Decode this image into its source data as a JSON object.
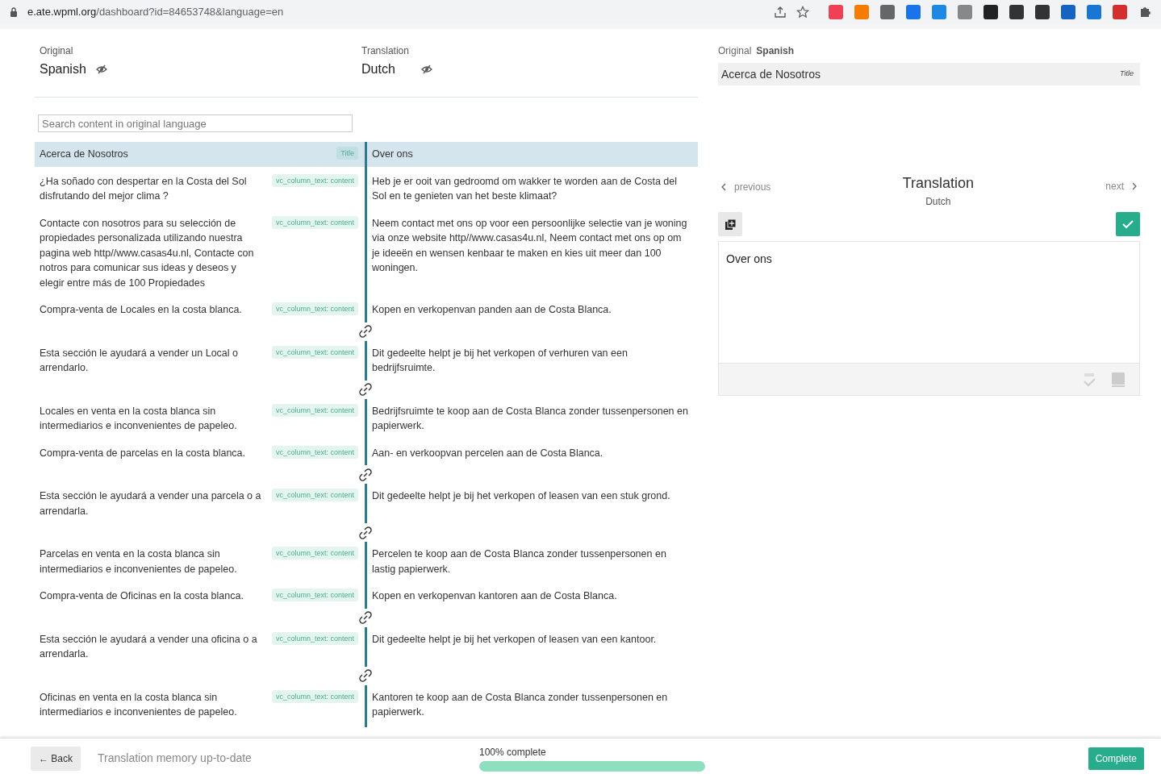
{
  "browser": {
    "url_host": "e.ate.wpml.org",
    "url_path": "/dashboard?id=84653748&language=en"
  },
  "header": {
    "original_label": "Original",
    "original_language": "Spanish",
    "translation_label": "Translation",
    "translation_language": "Dutch"
  },
  "search": {
    "placeholder": "Search content in original language"
  },
  "segments": [
    {
      "original": "Acerca de Nosotros",
      "tag": "Title",
      "translation": "Over ons",
      "selected": true,
      "linked_after": false
    },
    {
      "original": "¿Ha soñado con despertar en la Costa del Sol disfrutando del mejor clima ?",
      "tag": "vc_column_text: content",
      "translation": "Heb je er ooit van gedroomd om wakker te worden aan de Costa del Sol en te genieten van het beste klimaat?",
      "selected": false,
      "linked_after": false
    },
    {
      "original": "Contacte con nosotros para su selección de propiedades personalizada utilizando nuestra pagina web http//www.casas4u.nl, Contacte con notros para comunicar sus ideas y deseos y elegir entre más de 100 Propiedades",
      "tag": "vc_column_text: content",
      "translation": "Neem contact met ons op voor een persoonlijke selectie van je woning via onze website http//www.casas4u.nl, Neem contact met ons op om je ideeën en wensen kenbaar te maken en kies uit meer dan 100 woningen.",
      "selected": false,
      "linked_after": false
    },
    {
      "original": "Compra-venta de Locales en la costa blanca.",
      "tag": "vc_column_text: content",
      "translation": "Kopen en verkopenvan panden aan de Costa Blanca.",
      "selected": false,
      "linked_after": true
    },
    {
      "original": "Esta sección le ayudará a vender un Local o arrendarlo.",
      "tag": "vc_column_text: content",
      "translation": "Dit gedeelte helpt je bij het verkopen of verhuren van een bedrijfsruimte.",
      "selected": false,
      "linked_after": true
    },
    {
      "original": "Locales en venta en la costa blanca sin intermediarios e inconvenientes de papeleo.",
      "tag": "vc_column_text: content",
      "translation": "Bedrijfsruimte te koop aan de Costa Blanca zonder tussenpersonen en papierwerk.",
      "selected": false,
      "linked_after": false
    },
    {
      "original": "Compra-venta de parcelas en la costa blanca.",
      "tag": "vc_column_text: content",
      "translation": "Aan- en verkoopvan percelen aan de Costa Blanca.",
      "selected": false,
      "linked_after": true
    },
    {
      "original": "Esta sección le ayudará a vender una parcela o a arrendarla.",
      "tag": "vc_column_text: content",
      "translation": "Dit gedeelte helpt je bij het verkopen of leasen van een stuk grond.",
      "selected": false,
      "linked_after": true
    },
    {
      "original": "Parcelas en venta en la costa blanca sin intermediarios e inconvenientes de papeleo.",
      "tag": "vc_column_text: content",
      "translation": "Percelen te koop aan de Costa Blanca zonder tussenpersonen en lastig papierwerk.",
      "selected": false,
      "linked_after": false
    },
    {
      "original": "Compra-venta de Oficinas en la costa blanca.",
      "tag": "vc_column_text: content",
      "translation": "Kopen en verkopenvan kantoren aan de Costa Blanca.",
      "selected": false,
      "linked_after": true
    },
    {
      "original": "Esta sección le ayudará a vender una oficina o a arrendarla.",
      "tag": "vc_column_text: content",
      "translation": "Dit gedeelte helpt je bij het verkopen of leasen van een kantoor.",
      "selected": false,
      "linked_after": true
    },
    {
      "original": "Oficinas en venta en la costa blanca sin intermediarios e inconvenientes de papeleo.",
      "tag": "vc_column_text: content",
      "translation": "Kantoren te koop aan de Costa Blanca zonder tussenpersonen en papierwerk.",
      "selected": false,
      "linked_after": false
    }
  ],
  "editor": {
    "original_label": "Original",
    "original_language": "Spanish",
    "original_text": "Acerca de Nosotros",
    "original_tag": "Title",
    "previous": "previous",
    "title": "Translation",
    "language": "Dutch",
    "next": "next",
    "translation_text": "Over ons"
  },
  "footer": {
    "back": "← Back",
    "memory_status": "Translation memory up-to-date",
    "progress_label": "100% complete",
    "level": 1,
    "complete": "Complete"
  }
}
